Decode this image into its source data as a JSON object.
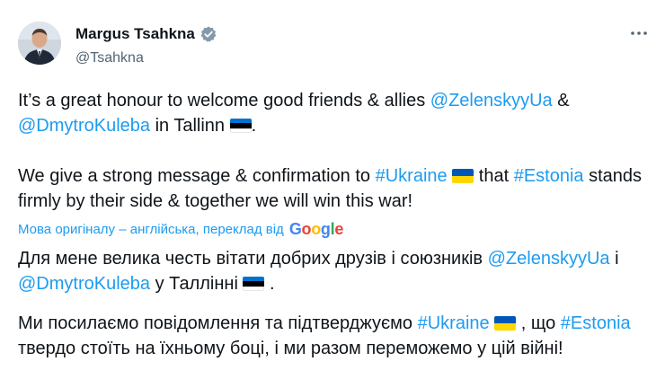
{
  "author": {
    "display_name": "Margus Tsahkna",
    "handle": "@Tsahkna"
  },
  "original": {
    "p1_pre": "It’s a great honour to welcome good friends & allies ",
    "p1_mention1": "@ZelenskyyUa",
    "p1_mid": "  & ",
    "p1_mention2": "@DmytroKuleba",
    "p1_post": " in Tallinn ",
    "p1_end": ".",
    "p2_pre": "We give a strong message & confirmation to ",
    "p2_tag1": "#Ukraine",
    "p2_mid": " that ",
    "p2_tag2": "#Estonia",
    "p2_post": " stands firmly by their side & together we will win this war!"
  },
  "translation": {
    "label": "Мова оригіналу – англійська, переклад від",
    "provider": "Google",
    "p1_pre": "Для мене велика честь вітати добрих друзів і союзників ",
    "p1_mention1": "@ZelenskyyUa",
    "p1_mid": " і ",
    "p1_mention2": "@DmytroKuleba",
    "p1_post": " у Таллінні ",
    "p1_end": " .",
    "p2_pre": "Ми посилаємо повідомлення та підтверджуємо ",
    "p2_tag1": "#Ukraine",
    "p2_mid": " , що ",
    "p2_tag2": "#Estonia",
    "p2_post": " твердо стоїть на їхньому боці, і ми разом переможемо у цій війні!"
  },
  "icons": {
    "verified": "verified-badge-icon",
    "more": "more-options-icon",
    "flag_estonia": "estonia-flag-icon",
    "flag_ukraine": "ukraine-flag-icon"
  },
  "colors": {
    "link": "#1d9bf0",
    "text": "#0f1419",
    "secondary": "#536471",
    "estonia_blue": "#0072ce",
    "ukraine_blue": "#0057b7",
    "ukraine_yellow": "#ffd700"
  }
}
